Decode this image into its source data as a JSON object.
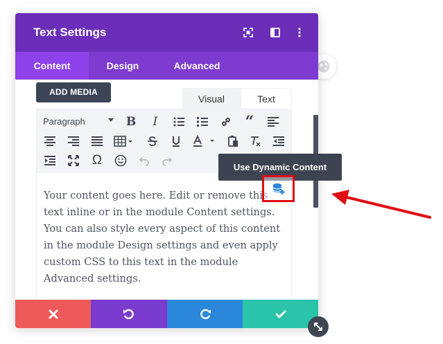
{
  "modal": {
    "title": "Text Settings",
    "header_icons": [
      "focus-icon",
      "split-view-icon",
      "more-icon"
    ],
    "tabs": [
      {
        "label": "Content",
        "active": true
      },
      {
        "label": "Design",
        "active": false
      },
      {
        "label": "Advanced",
        "active": false
      }
    ]
  },
  "editor": {
    "add_media_label": "ADD MEDIA",
    "mode_tabs": {
      "visual": "Visual",
      "text": "Text"
    },
    "format_select": "Paragraph",
    "content": "Your content goes here. Edit or remove this text inline or in the module Content settings. You can also style every aspect of this content in the module Design settings and even apply custom CSS to this text in the module Advanced settings."
  },
  "tooltip": {
    "label": "Use Dynamic Content"
  },
  "footer": {
    "buttons": [
      {
        "name": "cancel-button",
        "icon": "close-icon",
        "color": "#ee5a5a"
      },
      {
        "name": "undo-button",
        "icon": "undo-icon",
        "color": "#7a3bcf"
      },
      {
        "name": "redo-button",
        "icon": "redo-icon",
        "color": "#2b87da"
      },
      {
        "name": "save-button",
        "icon": "check-icon",
        "color": "#29c4a9"
      }
    ]
  },
  "colors": {
    "header": "#6c2eb9",
    "tabs_bar": "#7e3bd0",
    "active_tab": "#8f42ec",
    "highlight": "#e10d13"
  }
}
